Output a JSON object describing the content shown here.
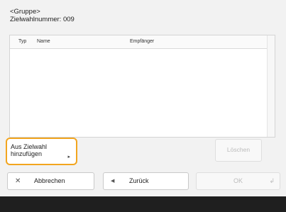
{
  "header": {
    "group": "<Gruppe>",
    "number": "Zielwahlnummer: 009"
  },
  "list": {
    "columns": [
      "Typ",
      "Name",
      "Empfänger"
    ],
    "rows": []
  },
  "actions": {
    "add_line1": "Aus Zielwahl",
    "add_line2": "hinzufügen",
    "add_arrow": "▸",
    "delete": "Löschen"
  },
  "bottom": {
    "cancel": "Abbrechen",
    "back": "Zurück",
    "ok": "OK"
  },
  "icons": {
    "cancel": "close-icon",
    "back": "back-arrow-icon",
    "ok": "enter-icon"
  },
  "colors": {
    "highlight": "#f2a51f",
    "footer": "#1f1f1f"
  }
}
